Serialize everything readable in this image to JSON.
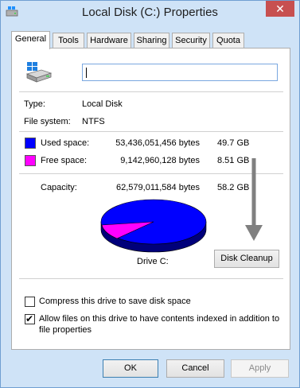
{
  "window": {
    "title": "Local Disk (C:) Properties",
    "close_label": "✕"
  },
  "tabs": [
    {
      "label": "General",
      "active": true
    },
    {
      "label": "Tools"
    },
    {
      "label": "Hardware"
    },
    {
      "label": "Sharing"
    },
    {
      "label": "Security"
    },
    {
      "label": "Quota"
    }
  ],
  "general": {
    "name_value": "",
    "type_label": "Type:",
    "type_value": "Local Disk",
    "fs_label": "File system:",
    "fs_value": "NTFS",
    "used": {
      "label": "Used space:",
      "bytes": "53,436,051,456 bytes",
      "size": "49.7 GB",
      "color": "#0000ff"
    },
    "free": {
      "label": "Free space:",
      "bytes": "9,142,960,128 bytes",
      "size": "8.51 GB",
      "color": "#ff00ff"
    },
    "capacity": {
      "label": "Capacity:",
      "bytes": "62,579,011,584 bytes",
      "size": "58.2 GB"
    },
    "drive_label": "Drive C:",
    "cleanup_label": "Disk Cleanup"
  },
  "options": {
    "compress": {
      "label": "Compress this drive to save disk space",
      "checked": false
    },
    "index": {
      "label_line1": "Allow files on this drive to have contents indexed in addition to",
      "label_line2": "file properties",
      "checked": true
    }
  },
  "footer": {
    "ok": "OK",
    "cancel": "Cancel",
    "apply": "Apply"
  }
}
